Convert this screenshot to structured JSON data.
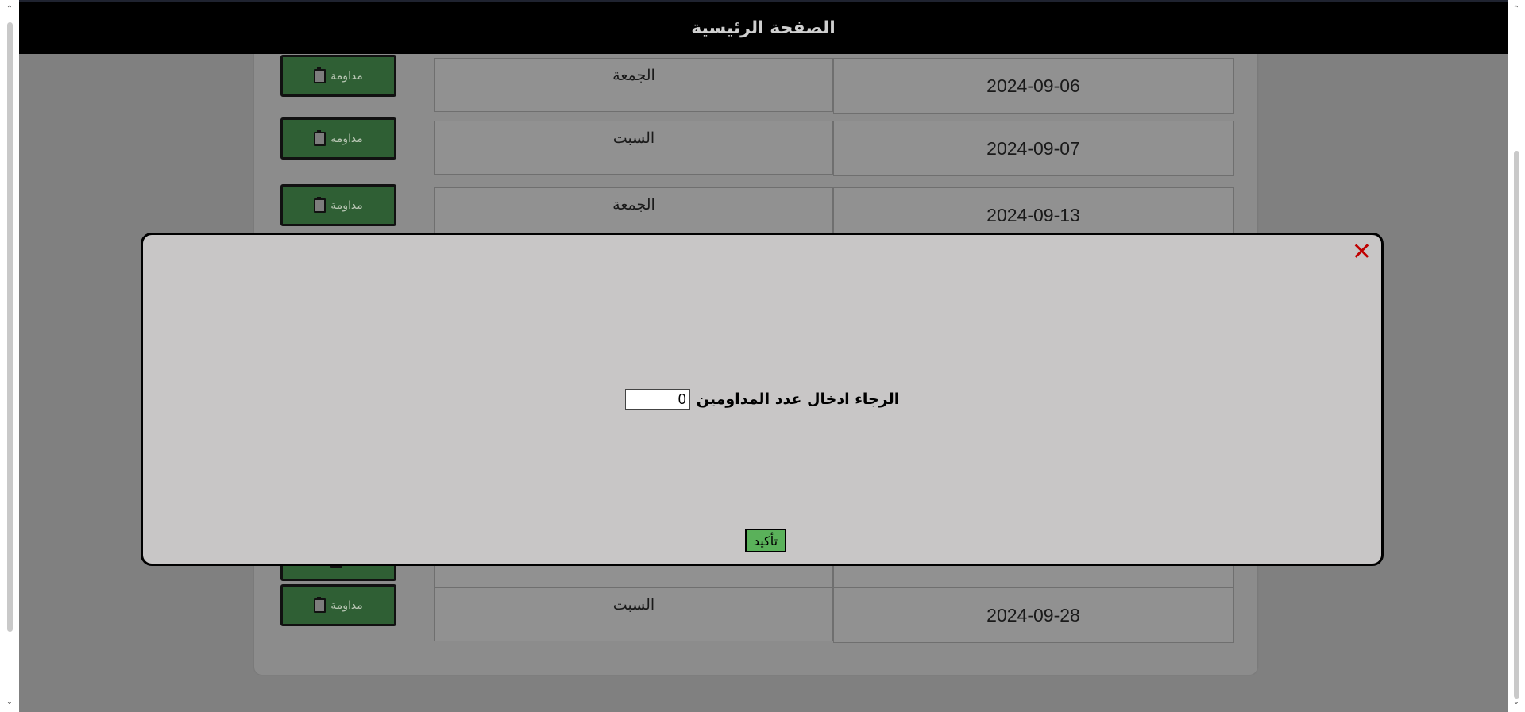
{
  "header": {
    "title": "الصفحة الرئيسية"
  },
  "rows": [
    {
      "date": "2024-09-06",
      "day": "الجمعة",
      "button_label": "مداومة"
    },
    {
      "date": "2024-09-07",
      "day": "السبت",
      "button_label": "مداومة"
    },
    {
      "date": "2024-09-13",
      "day": "الجمعة",
      "button_label": "مداومة"
    },
    {
      "date": "",
      "day": "",
      "button_label": ""
    },
    {
      "date": "2024-09-28",
      "day": "السبت",
      "button_label": "مداومة"
    }
  ],
  "modal": {
    "close_icon": "close-x-icon",
    "prompt_label": "الرجاء ادخال عدد المداومين",
    "input_value": "0",
    "confirm_label": "تأكيد"
  },
  "colors": {
    "header_bg": "#000000",
    "attendance_button": "#2f5f34",
    "confirm_button": "#5ab15a",
    "close_icon": "#c00000",
    "modal_bg": "#c8c6c6"
  }
}
